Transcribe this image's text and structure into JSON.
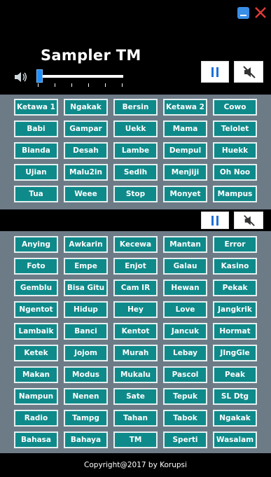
{
  "app": {
    "title": "Sampler TM",
    "volume": 0.0,
    "accent_color": "#0f8a8a",
    "panel_color": "#6d7b87"
  },
  "window_controls": {
    "minimize_icon": "minimize-icon",
    "close_icon": "close-icon"
  },
  "player_controls": {
    "pause_icon": "pause-icon",
    "mute_icon": "speaker-muted-icon",
    "volume_icon": "speaker-icon"
  },
  "group1": {
    "buttons": [
      "Ketawa 1",
      "Ngakak",
      "Bersin",
      "Ketawa 2",
      "Cowo",
      "Babi",
      "Gampar",
      "Uekk",
      "Mama",
      "Telolet",
      "Bianda",
      "Desah",
      "Lambe",
      "Dempul",
      "Huekk",
      "Ujian",
      "Malu2in",
      "Sedih",
      "Menjiji",
      "Oh Noo",
      "Tua",
      "Weee",
      "Stop",
      "Monyet",
      "Mampus"
    ]
  },
  "group2": {
    "buttons": [
      "Anying",
      "Awkarin",
      "Kecewa",
      "Mantan",
      "Error",
      "Foto",
      "Empe",
      "Enjot",
      "Galau",
      "Kasino",
      "Gemblu",
      "Bisa Gitu",
      "Cam IR",
      "Hewan",
      "Pekak",
      "Ngentot",
      "Hidup",
      "Hey",
      "Love",
      "Jangkrik",
      "Lambaik",
      "Banci",
      "Kentot",
      "Jancuk",
      "Hormat",
      "Ketek",
      "Jojom",
      "Murah",
      "Lebay",
      "JIngGle",
      "Makan",
      "Modus",
      "Mukalu",
      "Pascol",
      "Peak",
      "Nampun",
      "Nenen",
      "Sate",
      "Tepuk",
      "SL Dtg",
      "Radio",
      "Tampg",
      "Tahan",
      "Tabok",
      "Ngakak",
      "Bahasa",
      "Bahaya",
      "TM",
      "Sperti",
      "Wasalam"
    ]
  },
  "footer": {
    "text": "Copyright@2017 by Korupsi"
  }
}
